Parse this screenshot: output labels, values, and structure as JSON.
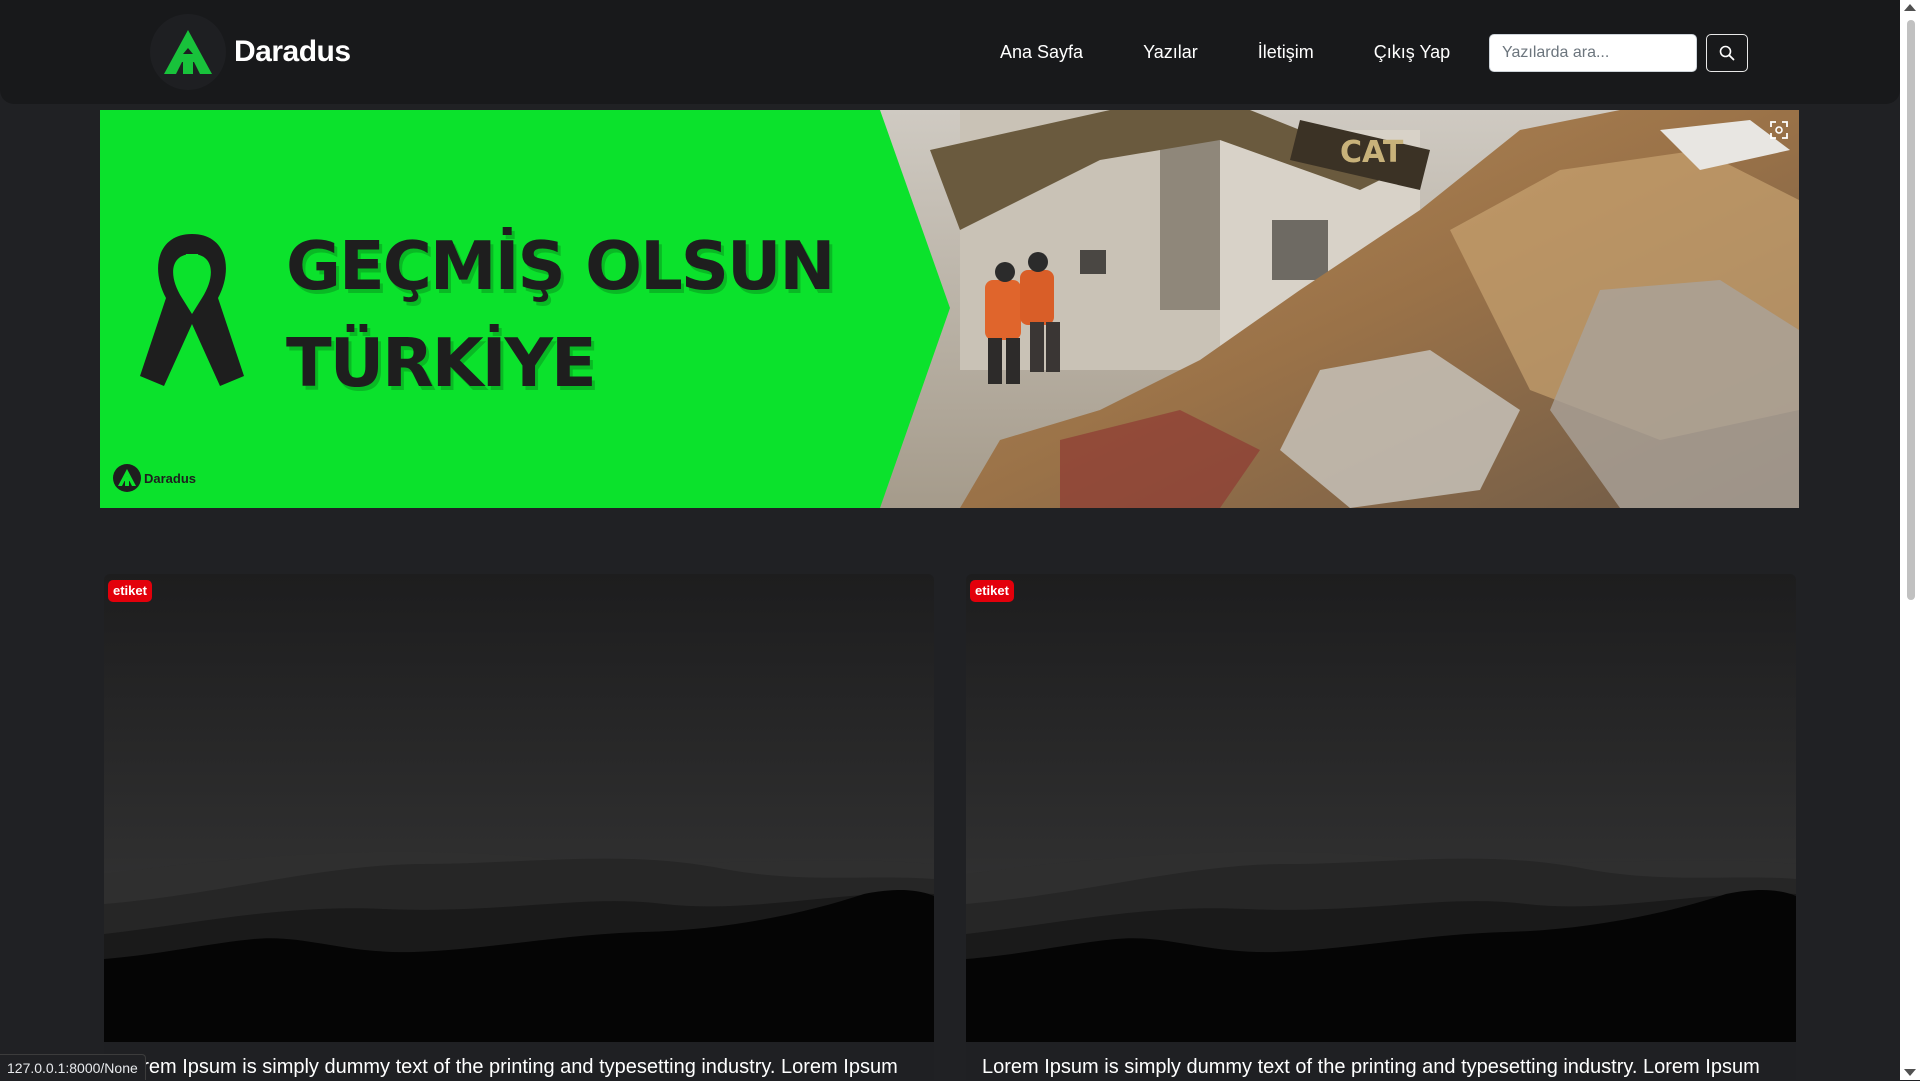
{
  "header": {
    "brand_name": "Daradus",
    "nav": [
      {
        "label": "Ana Sayfa"
      },
      {
        "label": "Yazılar"
      },
      {
        "label": "İletişim"
      },
      {
        "label": "Çıkış Yap"
      }
    ],
    "search": {
      "placeholder": "Yazılarda ara...",
      "icon": "search-icon"
    }
  },
  "banner": {
    "headline_line1": "GEÇMİŞ OLSUN",
    "headline_line2": "TÜRKİYE",
    "brand_name": "Daradus",
    "accent_color": "#0be22c",
    "icon": "ribbon-icon"
  },
  "posts": [
    {
      "tag": "etiket",
      "excerpt": "Lorem Ipsum is simply dummy text of the printing and typesetting industry. Lorem Ipsum"
    },
    {
      "tag": "etiket",
      "excerpt": "Lorem Ipsum is simply dummy text of the printing and typesetting industry. Lorem Ipsum"
    }
  ],
  "status_bar": {
    "url": "127.0.0.1:8000/None"
  },
  "colors": {
    "page_background": "#202124",
    "navbar_background": "#18191b",
    "tag_badge": "#e3000b",
    "logo_green": "#18c23b"
  }
}
